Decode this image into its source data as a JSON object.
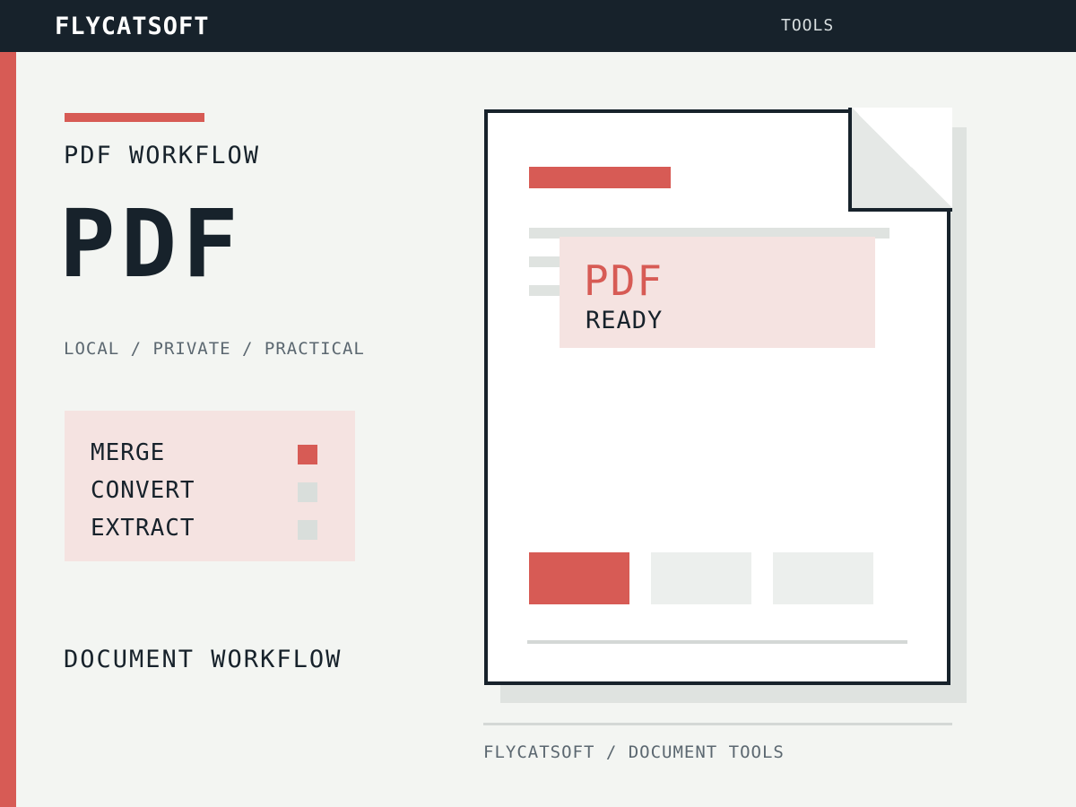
{
  "header": {
    "brand": "FLYCATSOFT",
    "nav_tools": "TOOLS"
  },
  "hero": {
    "eyebrow": "PDF WORKFLOW",
    "title": "PDF",
    "tagline": "LOCAL / PRIVATE / PRACTICAL"
  },
  "features": [
    {
      "label": "MERGE",
      "active": true
    },
    {
      "label": "CONVERT",
      "active": false
    },
    {
      "label": "EXTRACT",
      "active": false
    }
  ],
  "footer_label": "DOCUMENT WORKFLOW",
  "preview": {
    "status_title": "PDF",
    "status_sub": "READY"
  },
  "caption": "FLYCATSOFT / DOCUMENT TOOLS",
  "colors": {
    "accent": "#d75b55",
    "dark": "#17222b",
    "background": "#f3f5f2",
    "soft_pink": "#f5e3e1"
  }
}
